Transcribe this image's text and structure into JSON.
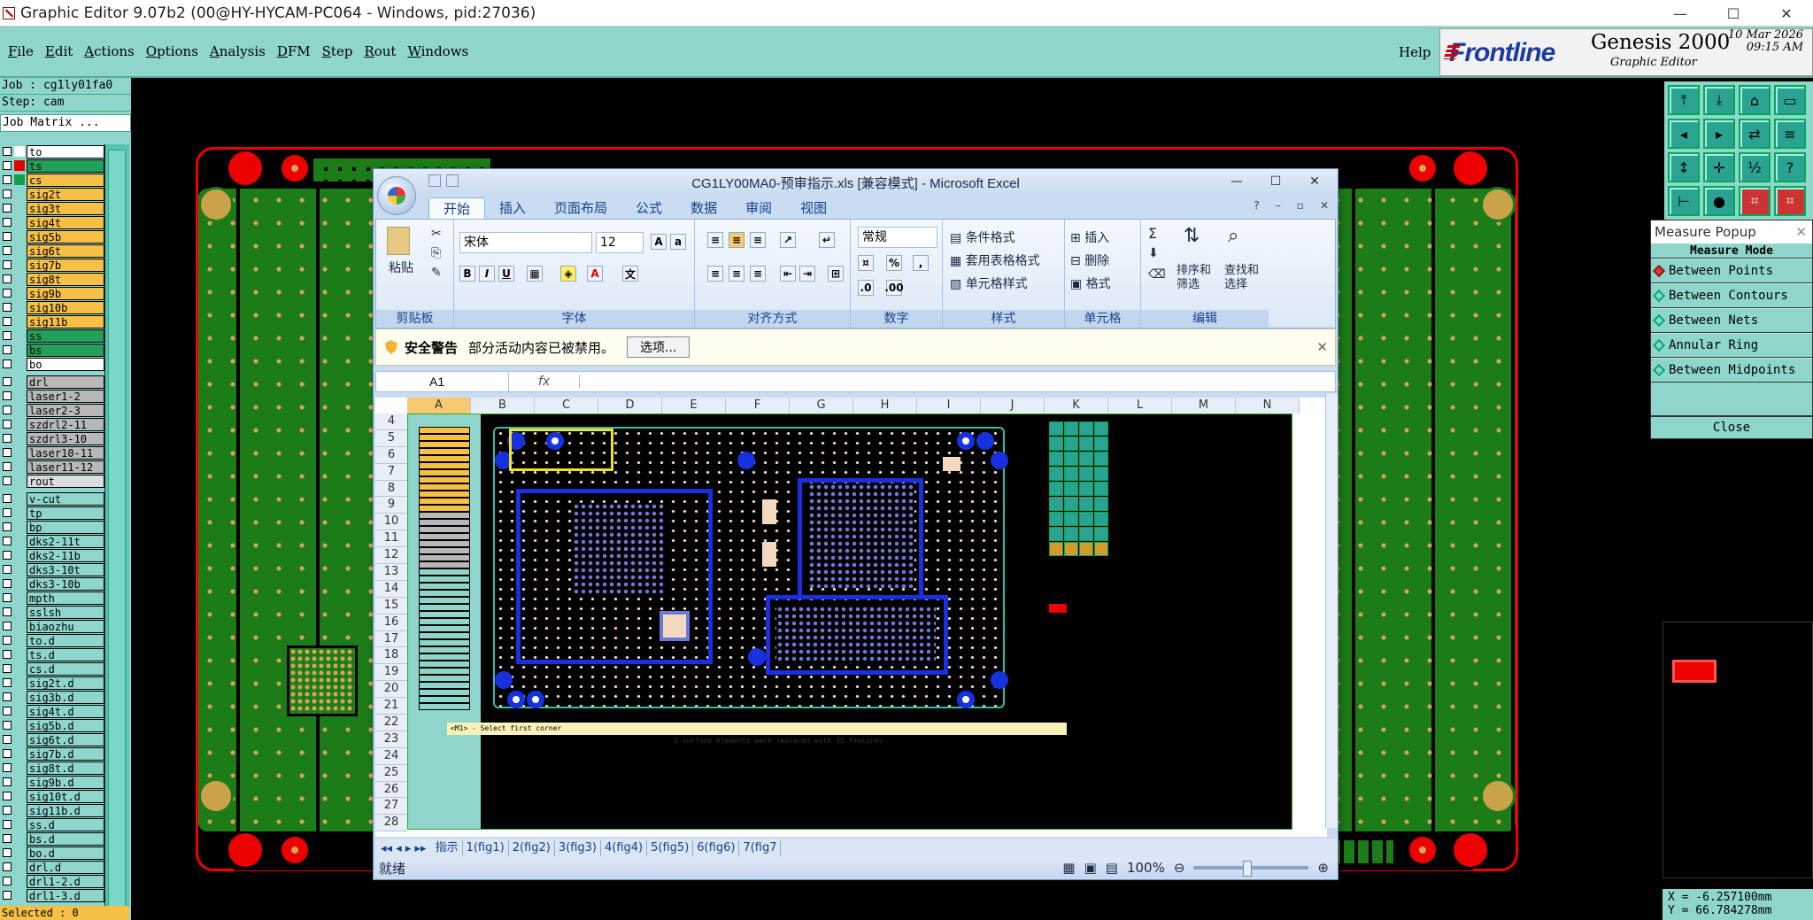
{
  "window": {
    "title": "Graphic Editor 9.07b2 (00@HY-HYCAM-PC064 - Windows, pid:27036)",
    "minimize": "—",
    "maximize": "☐",
    "close": "✕"
  },
  "menu": [
    "File",
    "Edit",
    "Actions",
    "Options",
    "Analysis",
    "DFM",
    "Step",
    "Rout",
    "Windows"
  ],
  "help": "Help",
  "brand": {
    "logo": "Frontline",
    "product": "Genesis 2000",
    "sub": "Graphic Editor",
    "date": "10 Mar 2026",
    "time": "09:15 AM"
  },
  "job": {
    "job_label": "Job : cg1ly01fa0",
    "step_label": "Step: cam",
    "matrix_button": "Job Matrix ..."
  },
  "layers": [
    {
      "name": "to",
      "swatch": "#ffffff",
      "bg": "#ffffff"
    },
    {
      "name": "ts",
      "swatch": "#e00000",
      "bg": "#22a05a"
    },
    {
      "name": "cs",
      "swatch": "#14a050",
      "bg": "#f5c045"
    },
    {
      "name": "sig2t",
      "swatch": "#8ed6cc",
      "bg": "#f5c045"
    },
    {
      "name": "sig3t",
      "swatch": "#8ed6cc",
      "bg": "#f5c045"
    },
    {
      "name": "sig4t",
      "swatch": "#8ed6cc",
      "bg": "#f5c045"
    },
    {
      "name": "sig5b",
      "swatch": "#8ed6cc",
      "bg": "#f5c045"
    },
    {
      "name": "sig6t",
      "swatch": "#8ed6cc",
      "bg": "#f5c045"
    },
    {
      "name": "sig7b",
      "swatch": "#8ed6cc",
      "bg": "#f5c045"
    },
    {
      "name": "sig8t",
      "swatch": "#8ed6cc",
      "bg": "#f5c045"
    },
    {
      "name": "sig9b",
      "swatch": "#8ed6cc",
      "bg": "#f5c045"
    },
    {
      "name": "sig10b",
      "swatch": "#8ed6cc",
      "bg": "#f5c045"
    },
    {
      "name": "sig11b",
      "swatch": "#8ed6cc",
      "bg": "#f5c045"
    },
    {
      "name": "ss",
      "swatch": "#8ed6cc",
      "bg": "#22a05a"
    },
    {
      "name": "bs",
      "swatch": "#8ed6cc",
      "bg": "#22a05a"
    },
    {
      "name": "bo",
      "swatch": "#8ed6cc",
      "bg": "#ffffff"
    },
    {
      "name": "drl",
      "swatch": "#8ed6cc",
      "bg": "#b8b8b8"
    },
    {
      "name": "laser1-2",
      "swatch": "#8ed6cc",
      "bg": "#b8b8b8"
    },
    {
      "name": "laser2-3",
      "swatch": "#8ed6cc",
      "bg": "#b8b8b8"
    },
    {
      "name": "szdrl2-11",
      "swatch": "#8ed6cc",
      "bg": "#b8b8b8"
    },
    {
      "name": "szdrl3-10",
      "swatch": "#8ed6cc",
      "bg": "#b8b8b8"
    },
    {
      "name": "laser10-11",
      "swatch": "#8ed6cc",
      "bg": "#b8b8b8"
    },
    {
      "name": "laser11-12",
      "swatch": "#8ed6cc",
      "bg": "#b8b8b8"
    },
    {
      "name": "rout",
      "swatch": "#8ed6cc",
      "bg": "#dcdcdc"
    },
    {
      "name": "v-cut",
      "swatch": "#8ed6cc",
      "bg": "#8ed6cc"
    },
    {
      "name": "tp",
      "swatch": "#8ed6cc",
      "bg": "#8ed6cc"
    },
    {
      "name": "bp",
      "swatch": "#8ed6cc",
      "bg": "#8ed6cc"
    },
    {
      "name": "dks2-11t",
      "swatch": "#8ed6cc",
      "bg": "#8ed6cc"
    },
    {
      "name": "dks2-11b",
      "swatch": "#8ed6cc",
      "bg": "#8ed6cc"
    },
    {
      "name": "dks3-10t",
      "swatch": "#8ed6cc",
      "bg": "#8ed6cc"
    },
    {
      "name": "dks3-10b",
      "swatch": "#8ed6cc",
      "bg": "#8ed6cc"
    },
    {
      "name": "mpth",
      "swatch": "#8ed6cc",
      "bg": "#8ed6cc"
    },
    {
      "name": "sslsh",
      "swatch": "#8ed6cc",
      "bg": "#8ed6cc"
    },
    {
      "name": "biaozhu",
      "swatch": "#8ed6cc",
      "bg": "#8ed6cc"
    },
    {
      "name": "to.d",
      "swatch": "#8ed6cc",
      "bg": "#8ed6cc"
    },
    {
      "name": "ts.d",
      "swatch": "#8ed6cc",
      "bg": "#8ed6cc"
    },
    {
      "name": "cs.d",
      "swatch": "#8ed6cc",
      "bg": "#8ed6cc"
    },
    {
      "name": "sig2t.d",
      "swatch": "#8ed6cc",
      "bg": "#8ed6cc"
    },
    {
      "name": "sig3b.d",
      "swatch": "#8ed6cc",
      "bg": "#8ed6cc"
    },
    {
      "name": "sig4t.d",
      "swatch": "#8ed6cc",
      "bg": "#8ed6cc"
    },
    {
      "name": "sig5b.d",
      "swatch": "#8ed6cc",
      "bg": "#8ed6cc"
    },
    {
      "name": "sig6t.d",
      "swatch": "#8ed6cc",
      "bg": "#8ed6cc"
    },
    {
      "name": "sig7b.d",
      "swatch": "#8ed6cc",
      "bg": "#8ed6cc"
    },
    {
      "name": "sig8t.d",
      "swatch": "#8ed6cc",
      "bg": "#8ed6cc"
    },
    {
      "name": "sig9b.d",
      "swatch": "#8ed6cc",
      "bg": "#8ed6cc"
    },
    {
      "name": "sig10t.d",
      "swatch": "#8ed6cc",
      "bg": "#8ed6cc"
    },
    {
      "name": "sig11b.d",
      "swatch": "#8ed6cc",
      "bg": "#8ed6cc"
    },
    {
      "name": "ss.d",
      "swatch": "#8ed6cc",
      "bg": "#8ed6cc"
    },
    {
      "name": "bs.d",
      "swatch": "#8ed6cc",
      "bg": "#8ed6cc"
    },
    {
      "name": "bo.d",
      "swatch": "#8ed6cc",
      "bg": "#8ed6cc"
    },
    {
      "name": "drl.d",
      "swatch": "#8ed6cc",
      "bg": "#8ed6cc"
    },
    {
      "name": "drl1-2.d",
      "swatch": "#8ed6cc",
      "bg": "#8ed6cc"
    },
    {
      "name": "drl1-3.d",
      "swatch": "#8ed6cc",
      "bg": "#8ed6cc"
    }
  ],
  "selected": "Selected : 0",
  "measure": {
    "title": "Measure Popup",
    "mode": "Measure Mode",
    "options": [
      "Between Points",
      "Between Contours",
      "Between Nets",
      "Annular Ring",
      "Between Midpoints"
    ],
    "active_index": 0,
    "close": "Close"
  },
  "coords": {
    "x": "X = -6.257100mm",
    "y": "Y = 66.784278mm"
  },
  "toolbar_icons": [
    "home-top-icon",
    "home-bottom-icon",
    "home-icon",
    "window-icon",
    "nav-left-icon",
    "nav-right-icon",
    "split-icon",
    "stack-icon",
    "fit-icon",
    "center-icon",
    "zoom-1-2-icon",
    "help-icon",
    "measure-icon",
    "probe-icon",
    "net-red-icon",
    "net-red2-icon"
  ],
  "excel": {
    "title": "CG1LY00MA0-预审指示.xls  [兼容模式] - Microsoft Excel",
    "tabs": [
      "开始",
      "插入",
      "页面布局",
      "公式",
      "数据",
      "审阅",
      "视图"
    ],
    "active_tab": 0,
    "groups": [
      "剪贴板",
      "字体",
      "对齐方式",
      "数字",
      "样式",
      "单元格",
      "编辑"
    ],
    "paste": "粘贴",
    "font_name": "宋体",
    "font_size": "12",
    "number_format": "常规",
    "style_items": [
      "条件格式",
      "套用表格格式",
      "单元格样式"
    ],
    "cell_items": [
      "插入",
      "删除",
      "格式"
    ],
    "edit_items": [
      "排序和筛选",
      "查找和选择"
    ],
    "security_label": "安全警告",
    "security_msg": "部分活动内容已被禁用。",
    "options_btn": "选项...",
    "namebox": "A1",
    "fx": "fx",
    "columns": [
      "A",
      "B",
      "C",
      "D",
      "E",
      "F",
      "G",
      "H",
      "I",
      "J",
      "K",
      "L",
      "M",
      "N"
    ],
    "rows": [
      "4",
      "5",
      "6",
      "7",
      "8",
      "9",
      "10",
      "11",
      "12",
      "13",
      "14",
      "15",
      "16",
      "17",
      "18",
      "19",
      "20",
      "21",
      "22",
      "23",
      "24",
      "25",
      "26",
      "27",
      "28"
    ],
    "embedded_cmd": "<M1> - Select first corner",
    "embedded_msg": "5 surface elements were replaced with 35 features",
    "sheet_tabs": [
      "指示",
      "1(fig1)",
      "2(fig2)",
      "3(fig3)",
      "4(fig4)",
      "5(fig5)",
      "6(fig6)",
      "7(fig7"
    ],
    "status": "就绪",
    "zoom": "100%"
  }
}
